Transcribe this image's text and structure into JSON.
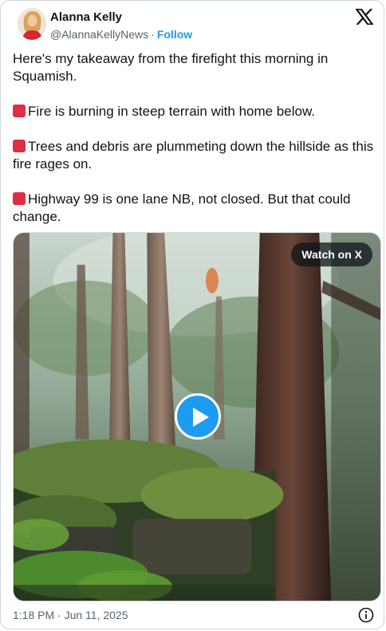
{
  "author": {
    "name": "Alanna Kelly",
    "handle": "@AlannaKellyNews",
    "separator": "·",
    "follow_label": "Follow"
  },
  "icons": {
    "platform": "x-logo-icon",
    "flag": "red-square-emoji",
    "play": "play-icon",
    "info": "info-icon"
  },
  "tweet": {
    "paragraphs": [
      {
        "text": "Here's my takeaway from the firefight this morning in Squamish.",
        "flag": false
      },
      {
        "text": "Fire is burning in steep terrain with home below.",
        "flag": true
      },
      {
        "text": "Trees and debris are plummeting down the hillside as this fire rages on.",
        "flag": true
      },
      {
        "text": "Highway 99 is one lane NB, not closed. But that could change.",
        "flag": true
      }
    ]
  },
  "media": {
    "watch_label": "Watch on X"
  },
  "footer": {
    "timestamp": "1:18 PM · Jun 11, 2025"
  },
  "colors": {
    "accent": "#1d9bf0",
    "flag": "#dd2e44",
    "secondary_text": "#536471"
  }
}
